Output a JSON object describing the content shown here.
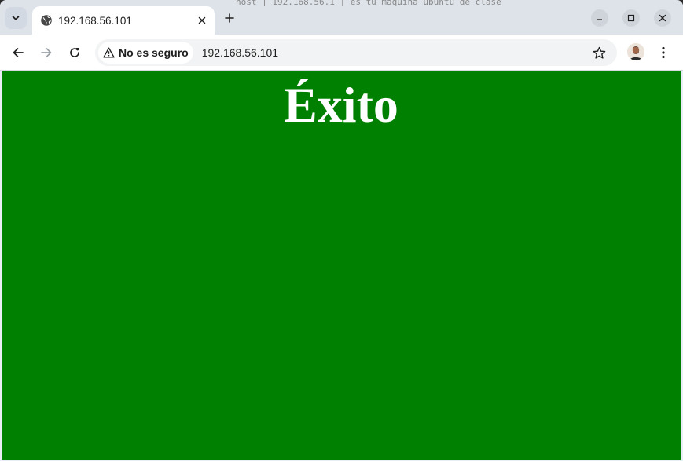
{
  "tabs": [
    {
      "title": "192.168.56.101",
      "icon": "globe-icon"
    }
  ],
  "background_terminal_text": "host  | 192.168.56.1   | es tu maquina ubuntu de clase",
  "toolbar": {
    "security_label": "No es seguro",
    "url": "192.168.56.101"
  },
  "page": {
    "heading": "Éxito",
    "background_color": "#008000",
    "text_color": "#ffffff"
  }
}
